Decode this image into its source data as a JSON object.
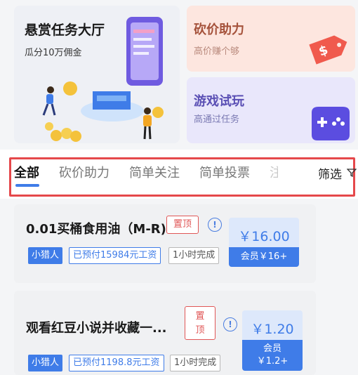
{
  "promo": {
    "main": {
      "title": "悬赏任务大厅",
      "subtitle": "瓜分10万佣金"
    },
    "bargain": {
      "title": "砍价助力",
      "subtitle": "高价赚个够"
    },
    "game": {
      "title": "游戏试玩",
      "subtitle": "高通过任务"
    }
  },
  "tabs": [
    "全部",
    "砍价助力",
    "简单关注",
    "简单投票",
    "注"
  ],
  "filter_label": "筛选",
  "tasks": [
    {
      "title": "0.01买桶食用油（M-R)",
      "pin": "置顶",
      "info": "!",
      "tags": [
        "小猎人",
        "已预付15984元工资",
        "1小时完成"
      ],
      "price": "￥16.00",
      "vip_price": "会员￥16+"
    },
    {
      "title": "观看红豆小说并收藏一...",
      "pin_line1": "置",
      "pin_line2": "顶",
      "info": "!",
      "tags": [
        "小猎人",
        "已预付1198.8元工资",
        "1小时完成"
      ],
      "price": "￥1.20",
      "vip_label": "会员",
      "vip_price": "￥1.2+"
    }
  ],
  "colors": {
    "accent": "#3f7ce8",
    "highlight_box": "#e5484b",
    "pin": "#e05656"
  }
}
